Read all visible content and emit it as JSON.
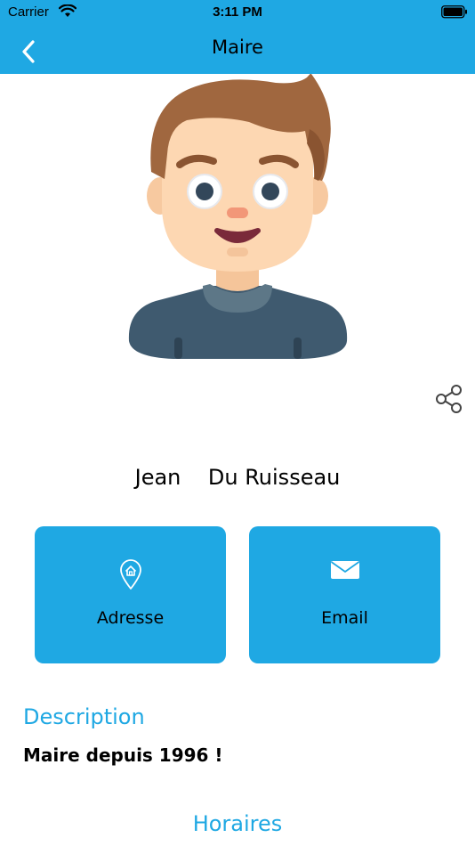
{
  "status_bar": {
    "carrier": "Carrier",
    "time": "3:11 PM"
  },
  "nav": {
    "title": "Maire",
    "back_icon": "chevron-left-icon"
  },
  "profile": {
    "full_name": "Jean    Du Ruisseau"
  },
  "actions": [
    {
      "label": "Adresse",
      "icon": "location-pin-icon"
    },
    {
      "label": "Email",
      "icon": "envelope-icon"
    }
  ],
  "description": {
    "title": "Description",
    "text": "Maire depuis 1996 !"
  },
  "hours": {
    "title": "Horaires"
  },
  "colors": {
    "accent": "#1fa8e3",
    "text": "#000000",
    "background": "#ffffff"
  }
}
